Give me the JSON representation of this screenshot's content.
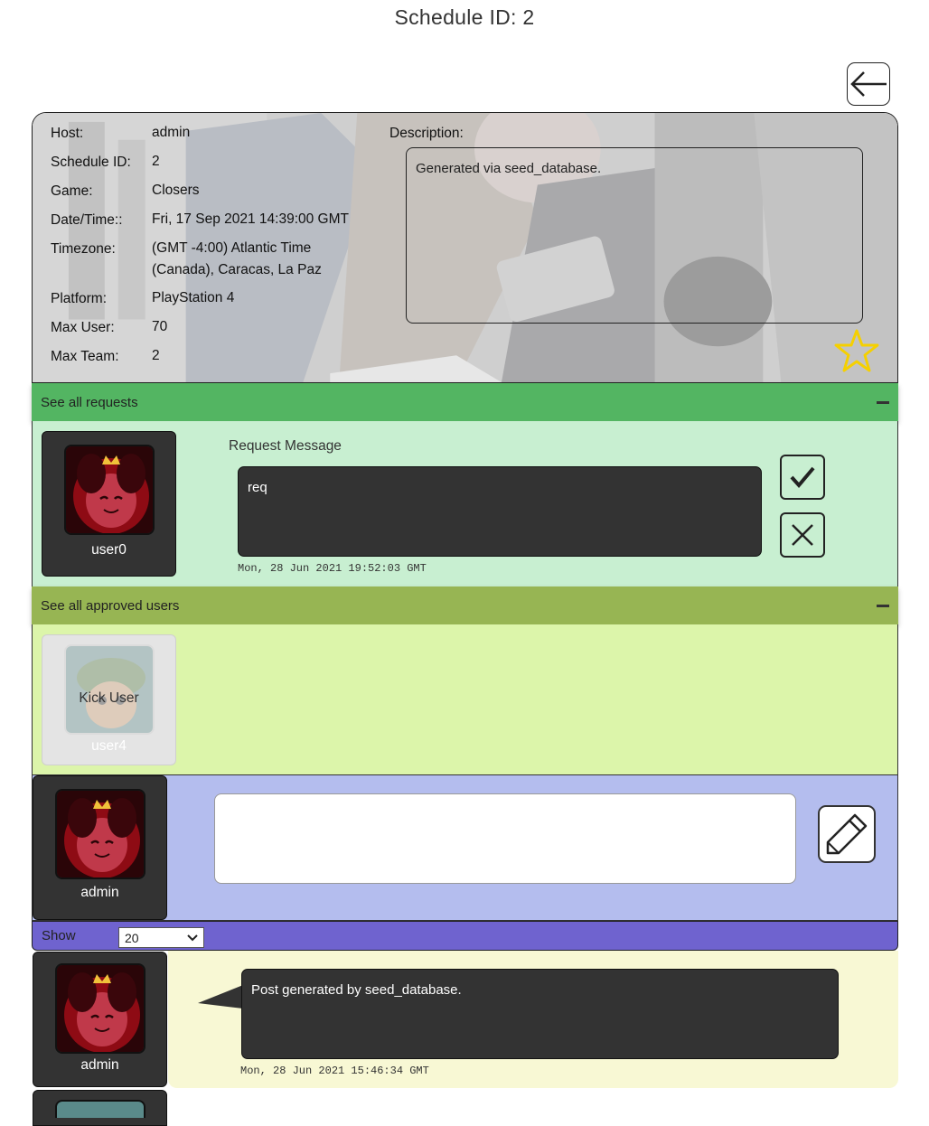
{
  "page": {
    "title": "Schedule ID: 2"
  },
  "schedule": {
    "fields": [
      {
        "label": "Host:",
        "value": "admin"
      },
      {
        "label": "Schedule ID:",
        "value": "2"
      },
      {
        "label": "Game:",
        "value": "Closers"
      },
      {
        "label": "Date/Time::",
        "value": "Fri, 17 Sep 2021 14:39:00 GMT"
      },
      {
        "label": "Timezone:",
        "value_line1": "(GMT -4:00) Atlantic Time",
        "value_line2": "(Canada), Caracas, La Paz"
      },
      {
        "label": "Platform:",
        "value": "PlayStation 4"
      },
      {
        "label": "Max User:",
        "value": "70"
      },
      {
        "label": "Max Team:",
        "value": "2"
      }
    ],
    "description_label": "Description:",
    "description": "Generated via seed_database."
  },
  "requests": {
    "header": "See all requests",
    "items": [
      {
        "username": "user0",
        "message_label": "Request Message",
        "message": "req",
        "timestamp": "Mon, 28 Jun 2021 19:52:03 GMT"
      }
    ]
  },
  "approved": {
    "header": "See all approved users",
    "users": [
      {
        "username": "user4",
        "action_label": "Kick User"
      }
    ]
  },
  "composer": {
    "username": "admin",
    "value": ""
  },
  "show": {
    "label": "Show",
    "selected": "20"
  },
  "posts": [
    {
      "username": "admin",
      "text": "Post generated by seed_database.",
      "timestamp": "Mon, 28 Jun 2021 15:46:34 GMT"
    }
  ],
  "colors": {
    "requests_header": "#53b562",
    "requests_body": "#c8efd1",
    "approved_header": "#97b553",
    "approved_body": "#dcf5aa",
    "composer_body": "#b4bdee",
    "show_bar": "#6f63cf",
    "post_body": "#f8f8d4",
    "star": "#f5d000"
  },
  "icons": {
    "back": "arrow-left-icon",
    "favorite": "star-outline-icon",
    "collapse": "minus-icon",
    "approve": "check-icon",
    "reject": "close-icon",
    "edit": "pencil-icon",
    "dropdown": "chevron-down-icon"
  }
}
